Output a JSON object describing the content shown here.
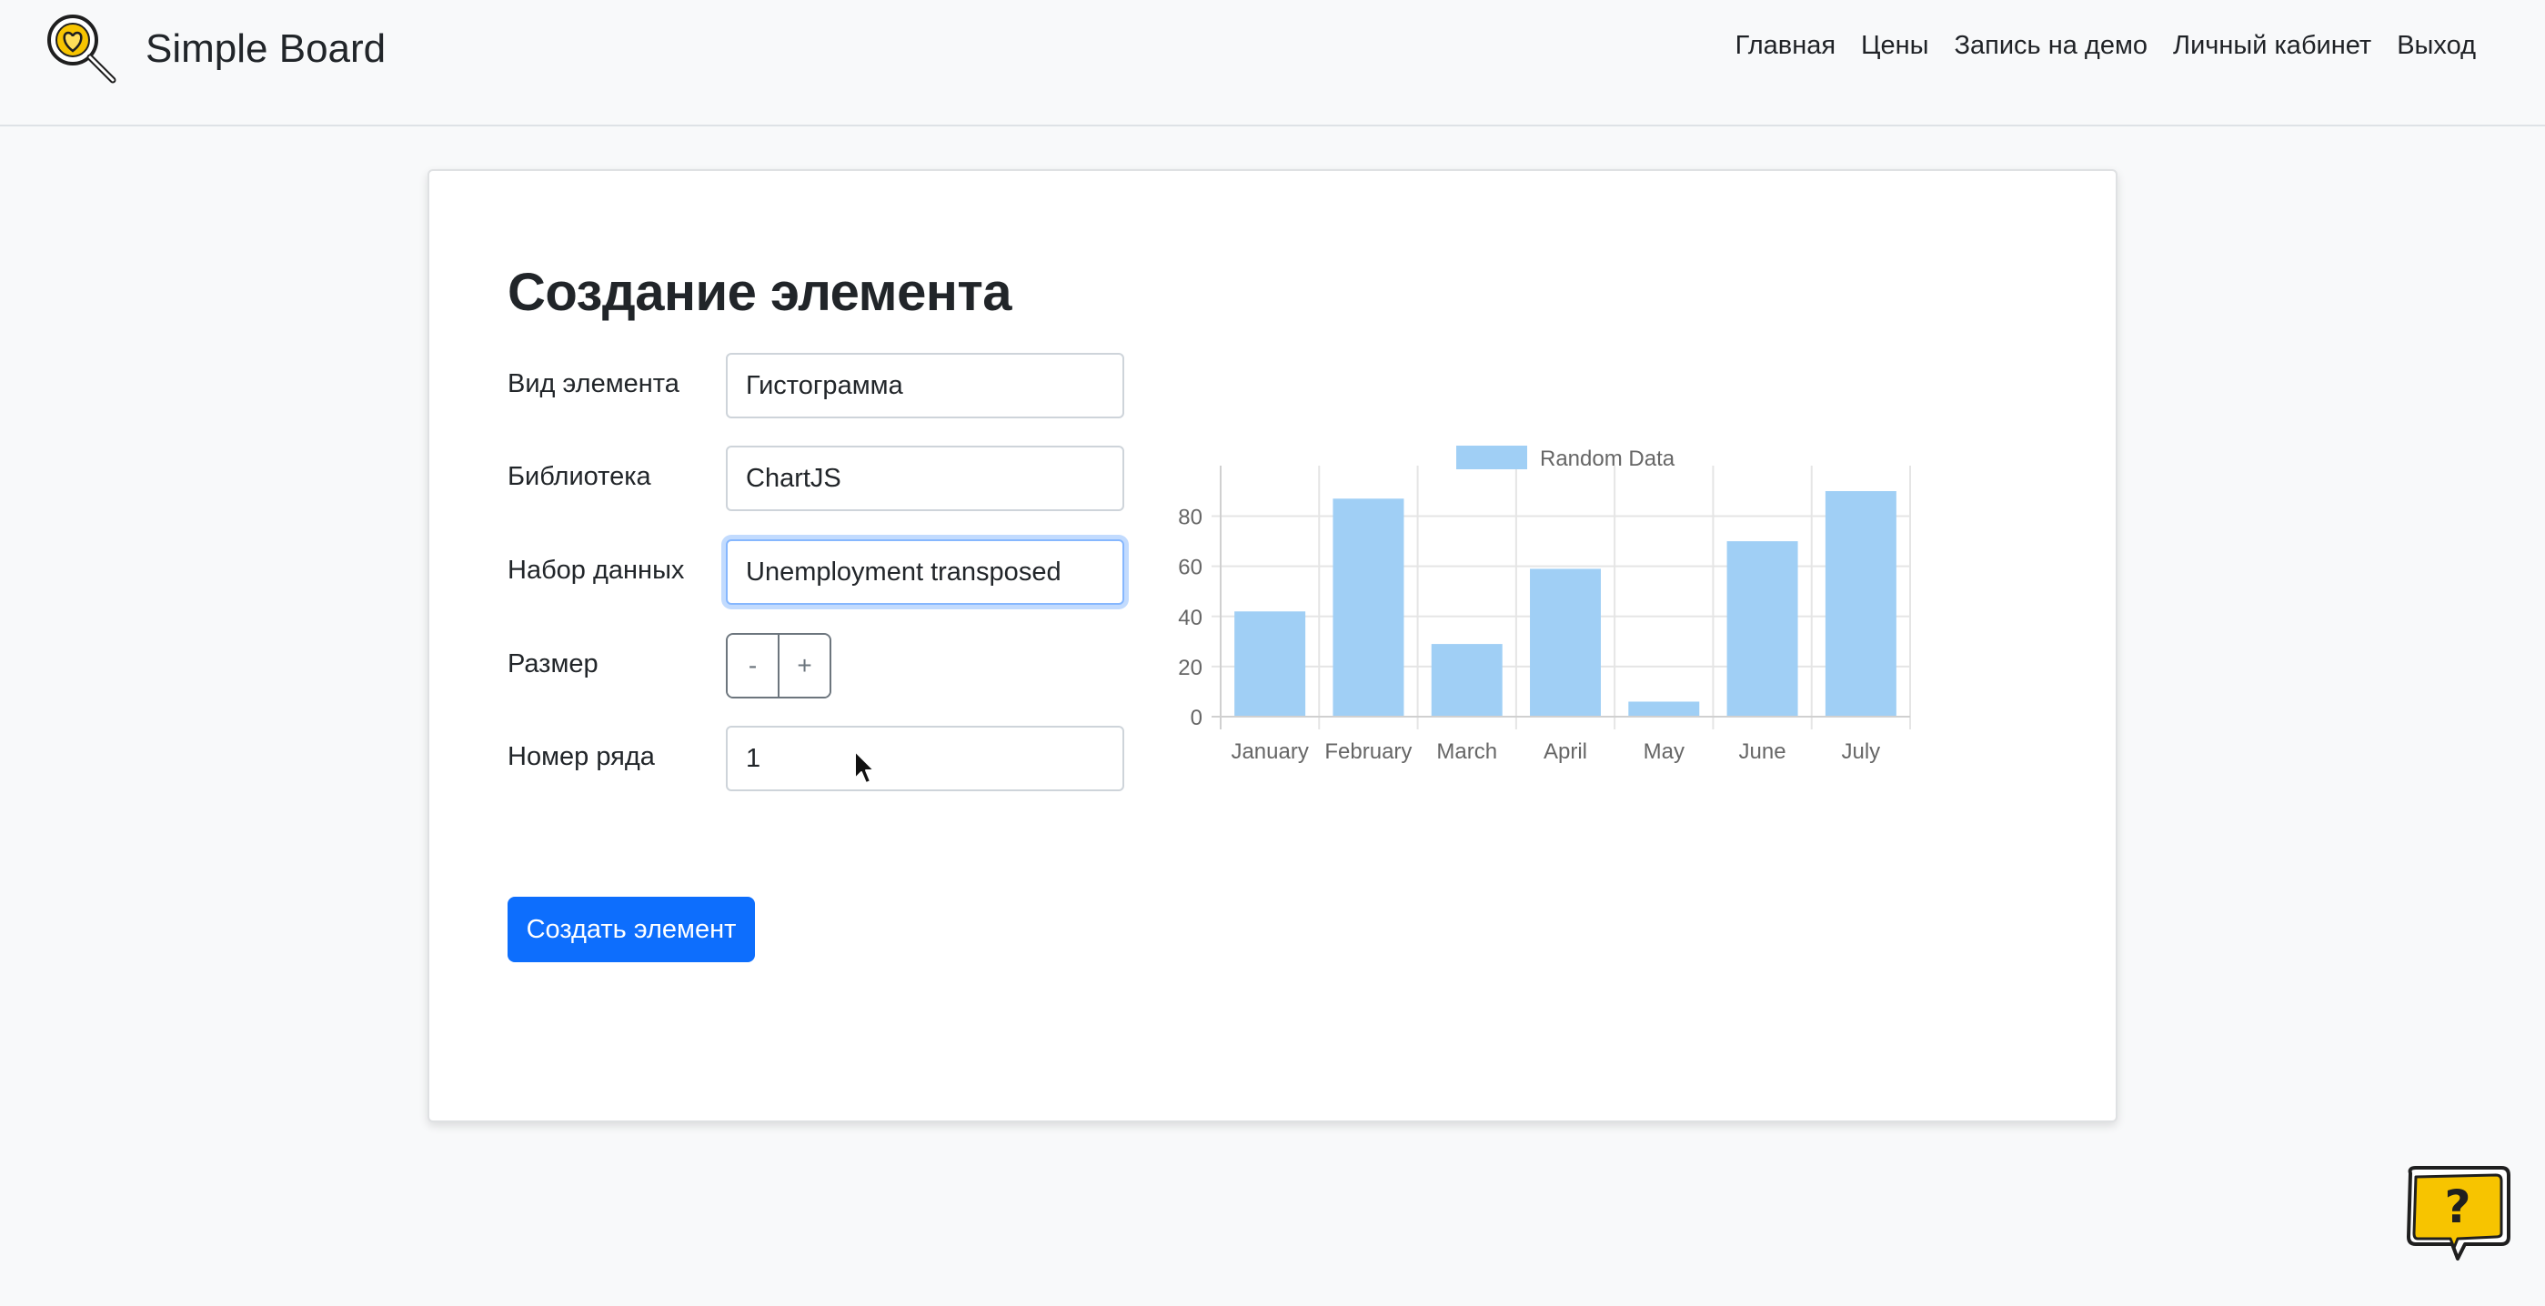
{
  "navbar": {
    "brand": "Simple Board",
    "links": [
      "Главная",
      "Цены",
      "Запись на демо",
      "Личный кабинет",
      "Выход"
    ]
  },
  "form": {
    "title": "Создание элемента",
    "element_type_label": "Вид элемента",
    "element_type_value": "Гистограмма",
    "library_label": "Библиотека",
    "library_value": "ChartJS",
    "dataset_label": "Набор данных",
    "dataset_value": "Unemployment transposed",
    "size_label": "Размер",
    "size_minus": "-",
    "size_plus": "+",
    "row_label": "Номер ряда",
    "row_value": "1",
    "submit_label": "Создать элемент"
  },
  "chart_data": {
    "type": "bar",
    "categories": [
      "January",
      "February",
      "March",
      "April",
      "May",
      "June",
      "July"
    ],
    "series": [
      {
        "name": "Random Data",
        "values": [
          42,
          87,
          29,
          59,
          6,
          70,
          90
        ]
      }
    ],
    "yticks": [
      0,
      20,
      40,
      60,
      80
    ],
    "ylim": [
      0,
      90
    ],
    "bar_color": "#a0cff5",
    "grid": true,
    "legend": "top"
  },
  "colors": {
    "primary": "#0d6efd",
    "brand_accent": "#f7c400"
  },
  "icons": {
    "brand_logo": "magnifier-heart-icon",
    "help": "question-bubble-icon",
    "cursor": "mouse-pointer-icon"
  }
}
